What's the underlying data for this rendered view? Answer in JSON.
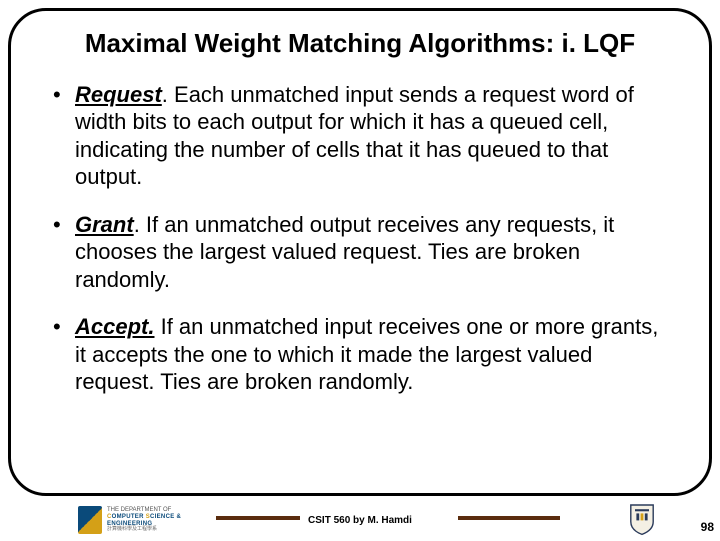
{
  "title": "Maximal Weight Matching Algorithms: i. LQF",
  "bullets": [
    {
      "term": "Request",
      "text": ". Each unmatched input sends a request word of width bits to each output for which it has a queued cell, indicating the number of cells that it has queued to that output."
    },
    {
      "term": "Grant",
      "text": ". If an unmatched output receives any requests, it chooses the largest valued request. Ties are broken randomly."
    },
    {
      "term": "Accept.",
      "text": " If an unmatched input receives one or more grants, it accepts the one to which it made the largest valued request. Ties are broken randomly."
    }
  ],
  "footer": {
    "dept_line1": "THE DEPARTMENT OF",
    "dept_line2a": "C",
    "dept_line2b": "OMPUTER ",
    "dept_line2c": "S",
    "dept_line2d": "CIENCE &",
    "dept_line3a": "E",
    "dept_line3b": "NGINEERING",
    "dept_line4": "計算機科學及工程學系",
    "credit": "CSIT 560 by M. Hamdi",
    "page": "98"
  }
}
